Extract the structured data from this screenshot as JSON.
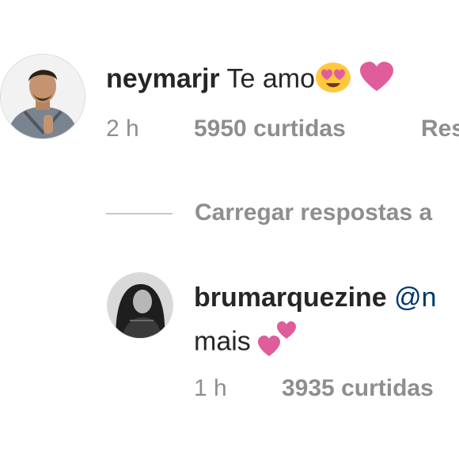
{
  "comments": [
    {
      "username": "neymarjr",
      "text": "Te amo",
      "emojis": [
        "smiling-face-with-heart-eyes-icon",
        "heart-icon"
      ],
      "time": "2 h",
      "likes": "5950 curtidas",
      "reply": "Res"
    },
    {
      "username": "brumarquezine",
      "mention": "@n",
      "text": "mais",
      "emojis": [
        "two-hearts-icon"
      ],
      "time": "1 h",
      "likes": "3935 curtidas"
    }
  ],
  "load_replies": "Carregar respostas a",
  "colors": {
    "text": "#262626",
    "meta": "#8e8e8e",
    "mention": "#00376b",
    "heart": "#e05d9c",
    "emoji_face": "#ffc83d"
  }
}
